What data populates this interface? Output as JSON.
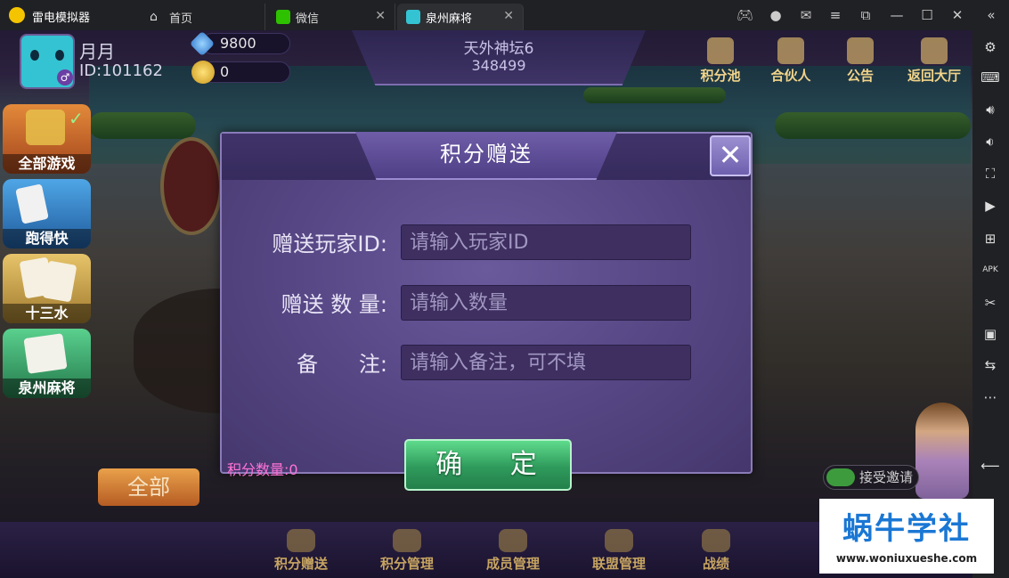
{
  "titlebar": {
    "app_name": "雷电模拟器",
    "tabs": [
      {
        "label": "首页"
      },
      {
        "label": "微信"
      },
      {
        "label": "泉州麻将"
      }
    ],
    "controls": [
      "gamepad-icon",
      "user-icon",
      "mail-icon",
      "menu-icon",
      "restore-icon",
      "minimize-icon",
      "maximize-icon",
      "close-icon",
      "collapse-icon"
    ]
  },
  "sidebar": {
    "items": [
      "settings-icon",
      "keyboard-icon",
      "volume-up-icon",
      "volume-down-icon",
      "screenshot-icon",
      "record-icon",
      "add-window-icon",
      "apk-icon",
      "scissors-icon",
      "video-icon",
      "sync-icon",
      "more-icon",
      "back-icon"
    ]
  },
  "player": {
    "name": "月月",
    "id_text": "ID:101162",
    "diamonds": "9800",
    "coins": "0"
  },
  "room": {
    "name": "天外神坛6",
    "number": "348499"
  },
  "top_buttons": [
    {
      "label": "积分池",
      "icon": "points-pool-icon"
    },
    {
      "label": "合伙人",
      "icon": "handshake-icon"
    },
    {
      "label": "公告",
      "icon": "megaphone-icon"
    },
    {
      "label": "返回大厅",
      "icon": "return-arrow-icon"
    }
  ],
  "game_menu": [
    {
      "label": "全部游戏",
      "color": "#c56a2a"
    },
    {
      "label": "跑得快",
      "color": "#2a6fb0"
    },
    {
      "label": "十三水",
      "color": "#b8923a"
    },
    {
      "label": "泉州麻将",
      "color": "#3aa06a"
    }
  ],
  "all_button": "全部",
  "accept_invite": "接受邀请",
  "bottom_bar": [
    {
      "label": "积分赠送",
      "icon": "gift-points-icon"
    },
    {
      "label": "积分管理",
      "icon": "spade-icon"
    },
    {
      "label": "成员管理",
      "icon": "members-icon"
    },
    {
      "label": "联盟管理",
      "icon": "alliance-icon"
    },
    {
      "label": "战绩",
      "icon": "trophy-icon"
    }
  ],
  "modal": {
    "title": "积分赠送",
    "fields": [
      {
        "label": "赠送玩家ID:",
        "placeholder": "请输入玩家ID"
      },
      {
        "label": "赠送 数 量:",
        "placeholder": "请输入数量"
      },
      {
        "label": "备      注:",
        "placeholder": "请输入备注，可不填"
      }
    ],
    "points_label": "积分数量:0",
    "confirm_label": "确 定"
  },
  "watermark": {
    "title": "蜗牛学社",
    "url": "www.woniuxueshe.com"
  },
  "colors": {
    "modal_bg": "#574785",
    "confirm_green": "#2f9a5c",
    "points_pink": "#ff73d6"
  }
}
